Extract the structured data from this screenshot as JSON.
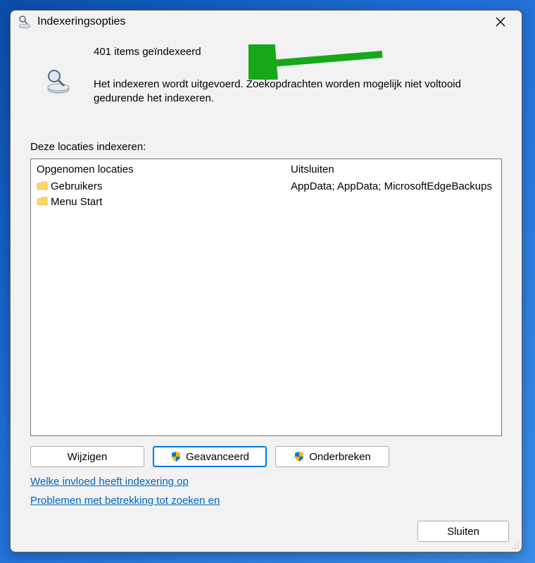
{
  "window": {
    "title": "Indexeringsopties"
  },
  "status": {
    "count_line": "401 items geïndexeerd",
    "message": "Het indexeren wordt uitgevoerd. Zoekopdrachten worden mogelijk niet voltooid gedurende het indexeren."
  },
  "locations": {
    "section_label": "Deze locaties indexeren:",
    "col_included": "Opgenomen locaties",
    "col_excluded": "Uitsluiten",
    "rows": [
      {
        "name": "Gebruikers",
        "exclude": "AppData; AppData; MicrosoftEdgeBackups"
      },
      {
        "name": "Menu Start",
        "exclude": ""
      }
    ]
  },
  "buttons": {
    "modify": "Wijzigen",
    "advanced": "Geavanceerd",
    "pause": "Onderbreken",
    "close": "Sluiten"
  },
  "links": {
    "influence": "Welke invloed heeft indexering op",
    "troubleshoot": "Problemen met betrekking tot zoeken en"
  }
}
